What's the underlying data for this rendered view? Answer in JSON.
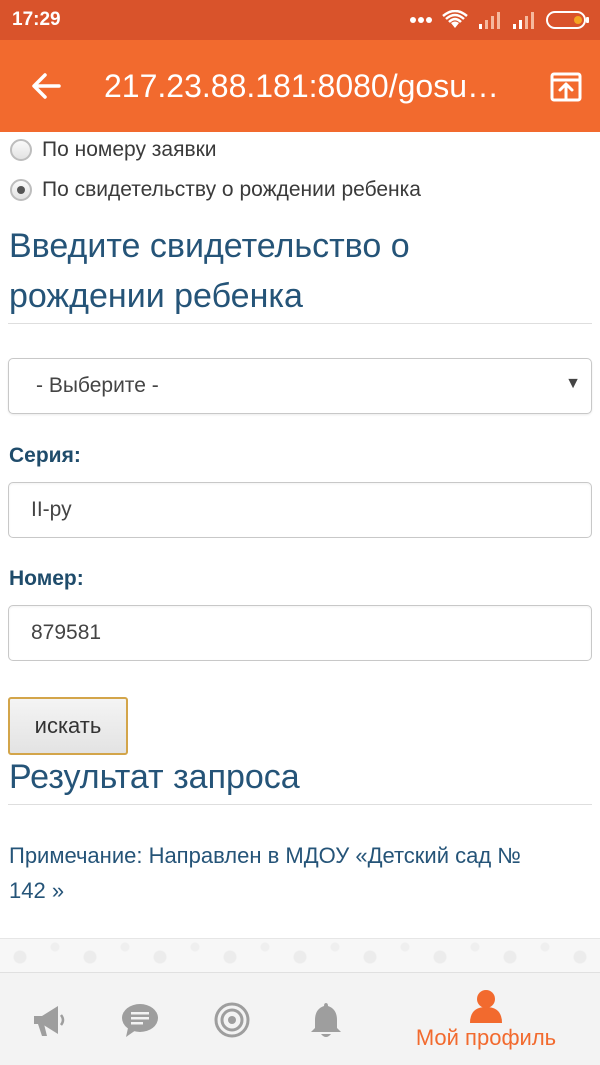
{
  "status_bar": {
    "time": "17:29"
  },
  "app_bar": {
    "url": "217.23.88.181:8080/gosu…",
    "back_icon": "arrow-left-icon",
    "open_icon": "open-in-browser-icon"
  },
  "search_mode": {
    "options": [
      {
        "label": "По номеру заявки",
        "checked": false
      },
      {
        "label": "По свидетельству о рождении ребенка",
        "checked": true
      }
    ]
  },
  "certificate_section": {
    "title_line1": "Введите свидетельство о",
    "title_line2": "рождении ребенка"
  },
  "form": {
    "type_select": {
      "value": "- Выберите -"
    },
    "series": {
      "label": "Серия:",
      "value": "II-ру"
    },
    "number": {
      "label": "Номер:",
      "value": "879581"
    },
    "search_button": "искать"
  },
  "result": {
    "title": "Результат запроса",
    "note_line1": "Примечание: Направлен в МДОУ «Детский сад №",
    "note_line2": "142 »"
  },
  "bottom_nav": {
    "items": [
      {
        "icon": "megaphone-icon",
        "label": ""
      },
      {
        "icon": "chat-icon",
        "label": ""
      },
      {
        "icon": "target-icon",
        "label": ""
      },
      {
        "icon": "bell-icon",
        "label": ""
      },
      {
        "icon": "profile-icon",
        "label": "Мой профиль",
        "active": true
      }
    ]
  },
  "colors": {
    "status_bar": "#d9532b",
    "app_bar": "#f26a2e",
    "heading_blue": "#255478",
    "nav_icon_grey": "#9e9e9e",
    "accent": "#f26a2e"
  }
}
